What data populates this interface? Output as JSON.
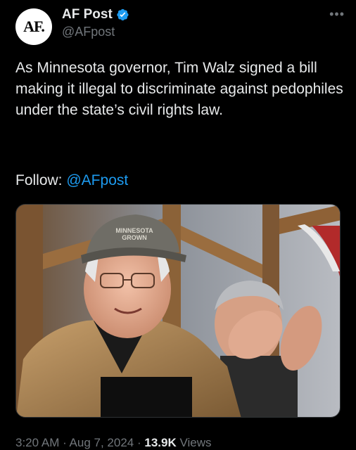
{
  "author": {
    "avatar_text": "AF.",
    "display_name": "AF Post",
    "handle": "@AFpost",
    "verified": true
  },
  "more_icon": "more-options-icon",
  "post": {
    "text": "As Minnesota governor, Tim Walz signed a bill making it illegal to discriminate against pedophiles under the state’s civil rights law.",
    "follow_label": "Follow: ",
    "follow_link": "@AFpost"
  },
  "media": {
    "cap_text_line1": "MINNESOTA",
    "cap_text_line2": "GROWN"
  },
  "meta": {
    "time": "3:20 AM",
    "sep1": " · ",
    "date": "Aug 7, 2024",
    "sep2": " · ",
    "views_count": "13.9K",
    "views_label": " Views"
  },
  "colors": {
    "background": "#000000",
    "text": "#e7e9ea",
    "secondary": "#71767b",
    "link": "#1d9bf0",
    "verified": "#1d9bf0"
  }
}
